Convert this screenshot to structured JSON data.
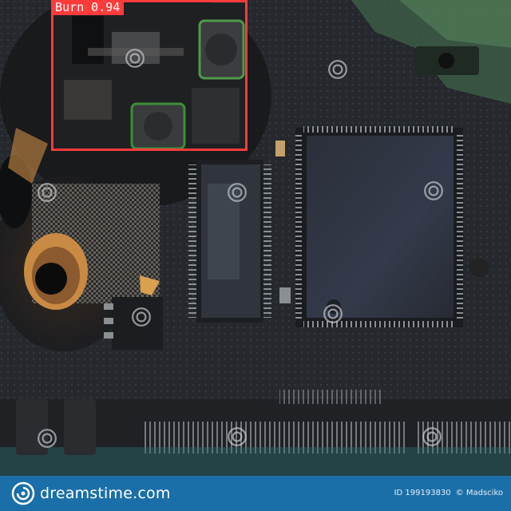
{
  "image": {
    "subject": "burnt circuit board"
  },
  "detection": {
    "label": "Burn",
    "score": "0.94",
    "box_color": "#ff3b3b"
  },
  "footer": {
    "brand": "dreamstime.com",
    "id_text": "ID 199193830",
    "author_text": "© Madsciko",
    "bar_color": "#1b6fa8"
  }
}
